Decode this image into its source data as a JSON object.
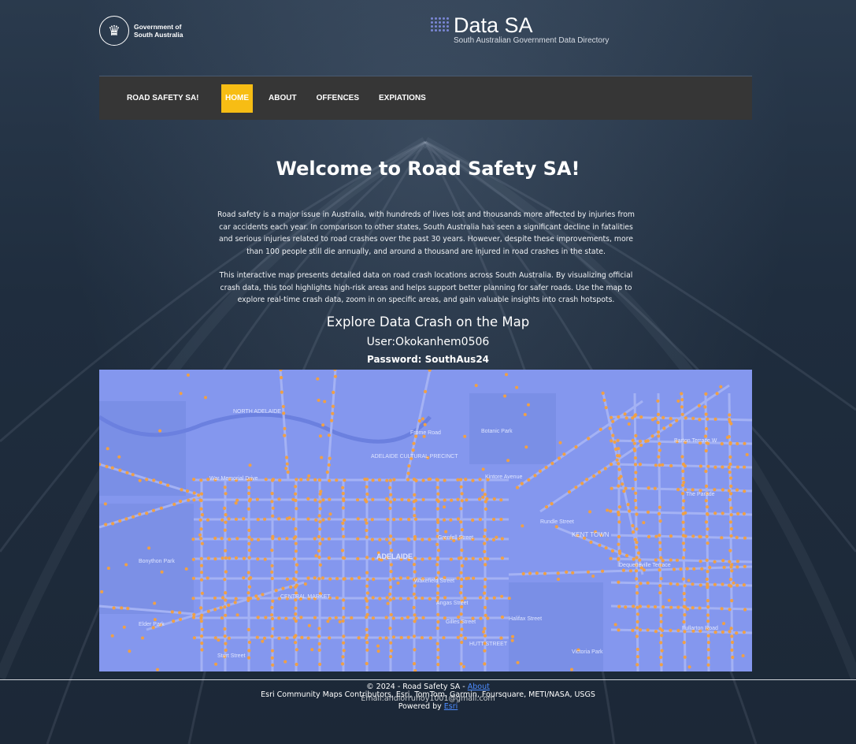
{
  "header": {
    "gov_logo_line1": "Government of",
    "gov_logo_line2": "South Australia",
    "datasa_title": "Data SA",
    "datasa_subtitle": "South Australian Government Data Directory"
  },
  "nav": {
    "brand": "ROAD SAFETY SA!",
    "items": [
      {
        "label": "HOME",
        "active": true
      },
      {
        "label": "ABOUT",
        "active": false
      },
      {
        "label": "OFFENCES",
        "active": false
      },
      {
        "label": "EXPIATIONS",
        "active": false
      }
    ]
  },
  "main": {
    "title": "Welcome to Road Safety SA!",
    "paragraph1": "Road safety is a major issue in Australia, with hundreds of lives lost and thousands more affected by injuries from car accidents each year. In comparison to other states, South Australia has seen a significant decline in fatalities and serious injuries related to road crashes over the past 30 years. However, despite these improvements, more than 100 people still die annually, and around a thousand are injured in road crashes in the state.",
    "paragraph2": "This interactive map presents detailed data on road crash locations across South Australia. By visualizing official crash data, this tool highlights high-risk areas and helps support better planning for safer roads. Use the map to explore real-time crash data, zoom in on specific areas, and gain valuable insights into crash hotspots.",
    "explore_heading": "Explore Data Crash on the Map",
    "user": "User:Okokanhem0506",
    "password": "Password: SouthAus24"
  },
  "map": {
    "labels": [
      "ADELAIDE",
      "NORTH ADELAIDE",
      "KENT TOWN",
      "ADELAIDE CULTURAL PRECINCT",
      "CENTRAL MARKET",
      "HUTT STREET",
      "The Parade",
      "Rundle Street",
      "Grenfell Street",
      "Wakefield Street",
      "Angas Street",
      "Gilles Street",
      "Halifax Street",
      "Sturt Street",
      "Victoria Park",
      "Botanic Park",
      "Bonython Park",
      "Kintore Avenue",
      "Barton Terrace W",
      "War Memorial Drive",
      "Elder Park",
      "Frome Road",
      "Dequetteville Terrace",
      "Fullarton Road"
    ],
    "colors": {
      "base": "#8497ee",
      "roads": "#9aaaf2",
      "dots": "#f0a045",
      "park": "#7c90e6"
    }
  },
  "footer": {
    "copyright": "© 2024 - Road Safety SA -",
    "about_link": "About",
    "attribution": "Esri Community Maps Contributors, Esri, TomTom, Garmin, Foursquare, METI/NASA, USGS",
    "email": "Email:andlorruhoy1001@gmail.com",
    "powered_by": "Powered by",
    "esri_link": "Esri"
  }
}
